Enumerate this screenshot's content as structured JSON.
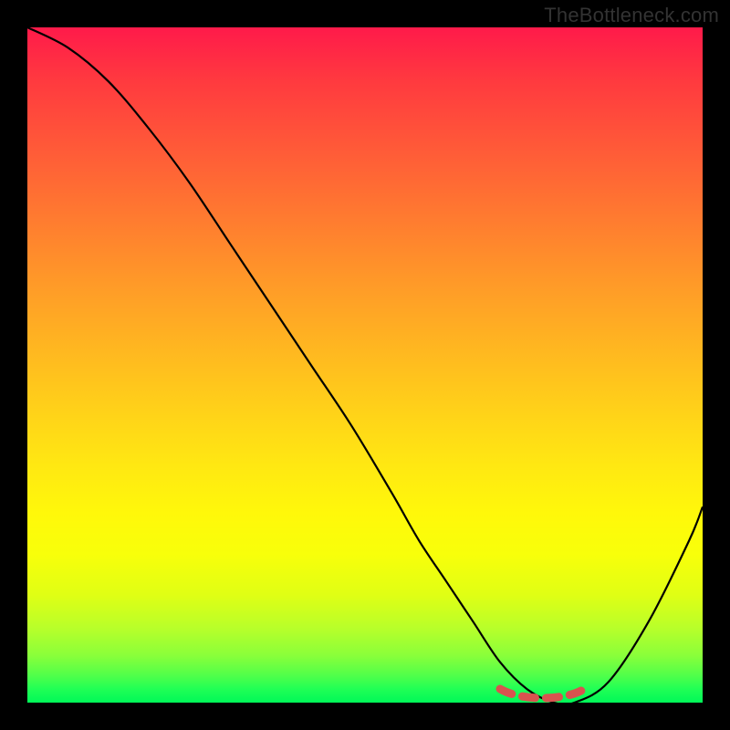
{
  "watermark": "TheBottleneck.com",
  "chart_data": {
    "type": "line",
    "title": "",
    "xlabel": "",
    "ylabel": "",
    "xlim": [
      0,
      100
    ],
    "ylim": [
      0,
      100
    ],
    "background_gradient": {
      "top_color": "#ff1a4a",
      "bottom_color": "#00f858",
      "meaning": "high-to-low bottleneck intensity"
    },
    "series": [
      {
        "name": "bottleneck-curve",
        "x": [
          0,
          6,
          12,
          18,
          24,
          30,
          36,
          42,
          48,
          54,
          58,
          62,
          66,
          70,
          74,
          78,
          81,
          86,
          92,
          98,
          100
        ],
        "values": [
          100,
          97,
          92,
          85,
          77,
          68,
          59,
          50,
          41,
          31,
          24,
          18,
          12,
          6,
          2,
          0,
          0,
          3,
          12,
          24,
          29
        ]
      }
    ],
    "trough_highlight": {
      "x_start": 70,
      "x_end": 82,
      "y": 0
    },
    "annotations": []
  }
}
